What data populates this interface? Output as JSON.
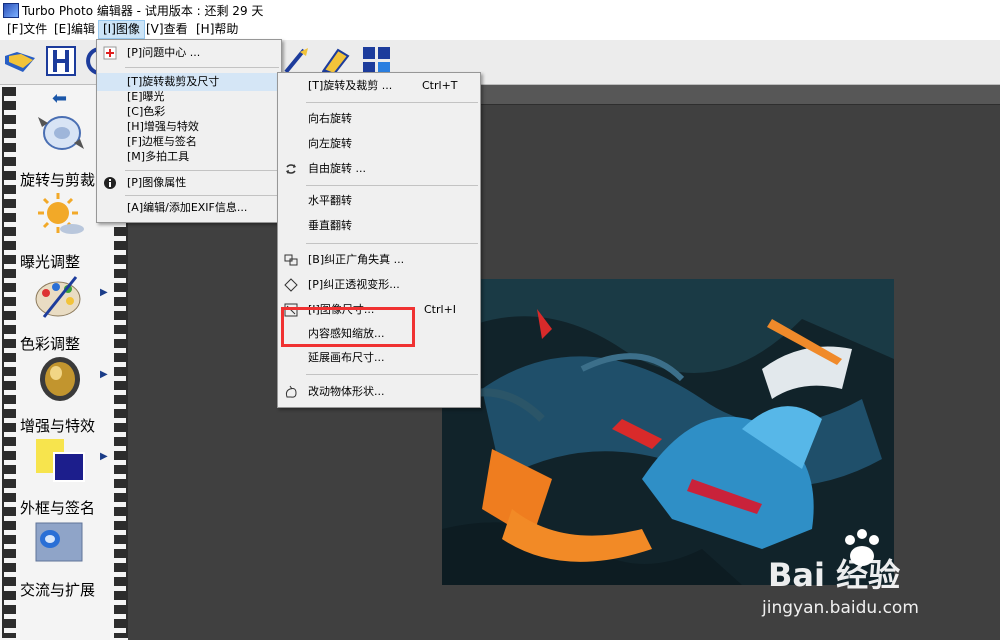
{
  "window": {
    "title": "Turbo Photo 编辑器 - 试用版本 : 还剩 29 天"
  },
  "menubar": [
    {
      "label": "[F]文件"
    },
    {
      "label": "[E]编辑"
    },
    {
      "label": "[I]图像"
    },
    {
      "label": "[V]查看"
    },
    {
      "label": "[H]帮助"
    }
  ],
  "sidebar": {
    "tools": [
      {
        "label": "旋转与剪裁",
        "icon": "rotate-crop-icon"
      },
      {
        "label": "曝光调整",
        "icon": "sun-exposure-icon"
      },
      {
        "label": "色彩调整",
        "icon": "palette-icon"
      },
      {
        "label": "增强与特效",
        "icon": "lens-filter-icon"
      },
      {
        "label": "外框与签名",
        "icon": "frame-signature-icon"
      },
      {
        "label": "交流与扩展",
        "icon": "share-extend-icon"
      }
    ]
  },
  "image_menu": {
    "items": [
      {
        "label": "[P]问题中心 ..."
      },
      {
        "label": "[T]旋转裁剪及尺寸"
      },
      {
        "label": "[E]曝光"
      },
      {
        "label": "[C]色彩"
      },
      {
        "label": "[H]增强与特效"
      },
      {
        "label": "[F]边框与签名"
      },
      {
        "label": "[M]多拍工具"
      },
      {
        "label": "[P]图像属性"
      },
      {
        "label": "[A]编辑/添加EXIF信息..."
      }
    ]
  },
  "submenu": {
    "items": [
      {
        "label": "[T]旋转及裁剪 ...",
        "shortcut": "Ctrl+T"
      },
      {
        "label": "向右旋转"
      },
      {
        "label": "向左旋转"
      },
      {
        "label": "自由旋转 ..."
      },
      {
        "label": "水平翻转"
      },
      {
        "label": "垂直翻转"
      },
      {
        "label": "[B]纠正广角失真 ..."
      },
      {
        "label": "[P]纠正透视变形..."
      },
      {
        "label": "[I]图像尺寸...",
        "shortcut": "Ctrl+I"
      },
      {
        "label": "内容感知缩放..."
      },
      {
        "label": "延展画布尺寸..."
      },
      {
        "label": "改动物体形状..."
      }
    ]
  },
  "watermark": {
    "brand": "Bai 经验",
    "url": "jingyan.baidu.com"
  },
  "colors": {
    "highlight_box": "#f03232",
    "canvas_bg": "#404040",
    "menu_hover": "#cce4f7"
  }
}
